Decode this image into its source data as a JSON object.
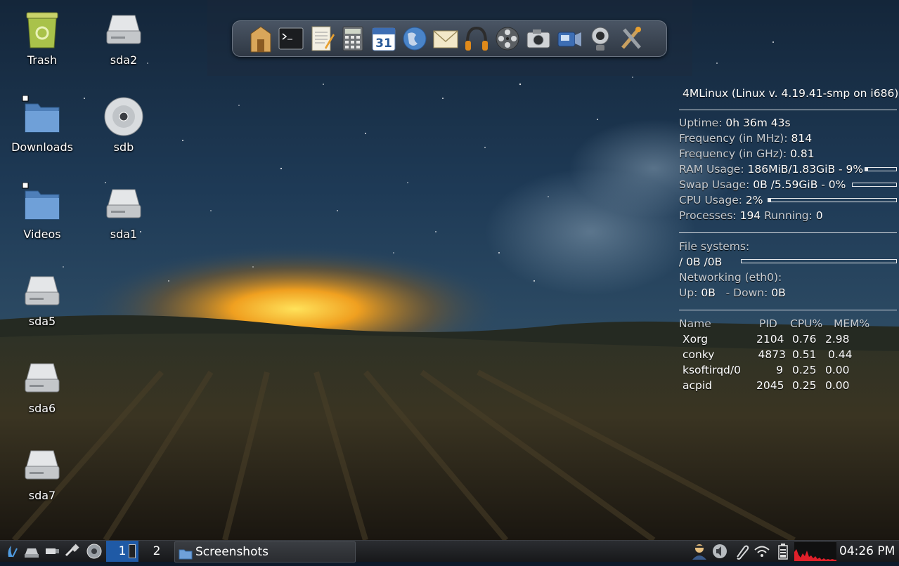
{
  "desktop": {
    "icons": [
      {
        "id": "trash",
        "label": "Trash",
        "icon": "trash-icon"
      },
      {
        "id": "sda2",
        "label": "sda2",
        "icon": "drive-icon"
      },
      {
        "id": "downloads",
        "label": "Downloads",
        "icon": "folder-icon"
      },
      {
        "id": "sdb",
        "label": "sdb",
        "icon": "optical-disc-icon"
      },
      {
        "id": "videos",
        "label": "Videos",
        "icon": "folder-icon"
      },
      {
        "id": "sda1",
        "label": "sda1",
        "icon": "drive-icon"
      },
      {
        "id": "sda5",
        "label": "sda5",
        "icon": "drive-icon"
      },
      {
        "id": "sda6",
        "label": "sda6",
        "icon": "drive-icon"
      },
      {
        "id": "sda7",
        "label": "sda7",
        "icon": "drive-icon"
      }
    ]
  },
  "dock": {
    "items": [
      "home-folder-icon",
      "terminal-icon",
      "text-editor-icon",
      "calculator-icon",
      "calendar-icon",
      "web-browser-icon",
      "mail-icon",
      "headphones-icon",
      "film-reel-icon",
      "camera-icon",
      "camcorder-icon",
      "webcam-icon",
      "tools-icon"
    ],
    "calendar_day": "31"
  },
  "conky": {
    "title": "4MLinux (Linux v. 4.19.41-smp on i686)",
    "uptime_label": "Uptime:",
    "uptime_value": "0h 36m 43s",
    "freq_mhz_label": "Frequency (in MHz):",
    "freq_mhz_value": "814",
    "freq_ghz_label": "Frequency (in GHz):",
    "freq_ghz_value": "0.81",
    "ram_label": "RAM Usage:",
    "ram_value": "186MiB/1.83GiB - 9%",
    "ram_fraction": 0.09,
    "swap_label": "Swap Usage:",
    "swap_value": "0B  /5.59GiB - 0%",
    "swap_fraction": 0.0,
    "cpu_label": "CPU Usage:",
    "cpu_value": "2%",
    "cpu_fraction": 0.02,
    "processes_label": "Processes:",
    "processes_value": "194",
    "running_label": "Running:",
    "running_value": "0",
    "fs_label": "File systems:",
    "fs_value": " /  0B  /0B",
    "fs_fraction": 0.0,
    "net_label": "Networking (eth0):",
    "up_label": "Up:",
    "up_value": "0B",
    "down_label": "- Down:",
    "down_value": "0B",
    "proc_headers": [
      "Name",
      "PID",
      "CPU%",
      "MEM%"
    ],
    "processes": [
      {
        "name": "Xorg",
        "pid": "2104",
        "cpu": "0.76",
        "mem": "2.98"
      },
      {
        "name": "conky",
        "pid": "4873",
        "cpu": "0.51",
        "mem": "0.44"
      },
      {
        "name": "ksoftirqd/0",
        "pid": "9",
        "cpu": "0.25",
        "mem": "0.00"
      },
      {
        "name": "acpid",
        "pid": "2045",
        "cpu": "0.25",
        "mem": "0.00"
      }
    ]
  },
  "taskbar": {
    "launchers": [
      "menu-icon",
      "drive-icon",
      "usb-icon",
      "network-cable-icon",
      "speaker-icon"
    ],
    "desktops": [
      "1",
      "2"
    ],
    "active_desktop": "1",
    "task_label": "Screenshots",
    "tray": [
      "user-icon",
      "volume-icon",
      "paperclip-icon",
      "wifi-icon",
      "battery-icon",
      "cpu-graph-icon"
    ],
    "clock": "04:26 PM",
    "colors": {
      "active_desktop": "#1f5aa6",
      "graph": "#e0202a"
    }
  }
}
